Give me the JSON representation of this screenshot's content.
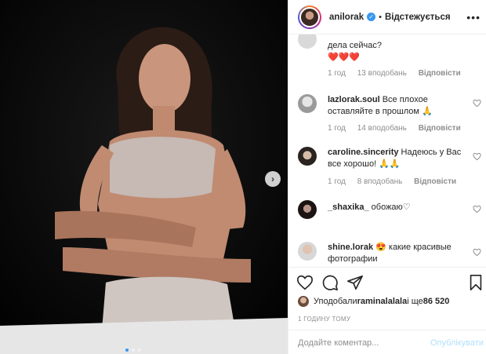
{
  "post": {
    "username": "anilorak",
    "separator": "•",
    "follow_label": "Відстежується",
    "verified_icon": "verified-check-icon",
    "carousel": {
      "dot_count": 3,
      "active_index": 0
    }
  },
  "comments": [
    {
      "username": "",
      "text": "дела сейчас?",
      "emoji": "❤️❤️❤️",
      "time": "1 год",
      "likes": "13 вподобань",
      "reply": "Відповісти"
    },
    {
      "username": "lazlorak.soul",
      "text": " Все плохое оставляйте в прошлом 🙏",
      "time": "1 год",
      "likes": "14 вподобань",
      "reply": "Відповісти"
    },
    {
      "username": "caroline.sincerity",
      "text": " Надеюсь у Вас все хорошо! 🙏🙏",
      "time": "1 год",
      "likes": "8 вподобань",
      "reply": "Відповісти"
    },
    {
      "username": "_shaxika_",
      "text": " обожаю♡"
    },
    {
      "username": "shine.lorak",
      "text": " 😍 какие красивые фотографии"
    }
  ],
  "likes": {
    "prefix": "Уподобали ",
    "user": "raminalalala",
    "middle": " і ще ",
    "count": "86 520"
  },
  "time_ago": "1 ГОДИНУ ТОМУ",
  "comment_input": {
    "placeholder": "Додайте коментар..."
  },
  "publish_label": "Опублікувати",
  "colors": {
    "accent": "#3897f0",
    "publish_disabled": "#b2dffc",
    "meta": "#8e8e8e",
    "heart": "#ed4956"
  }
}
